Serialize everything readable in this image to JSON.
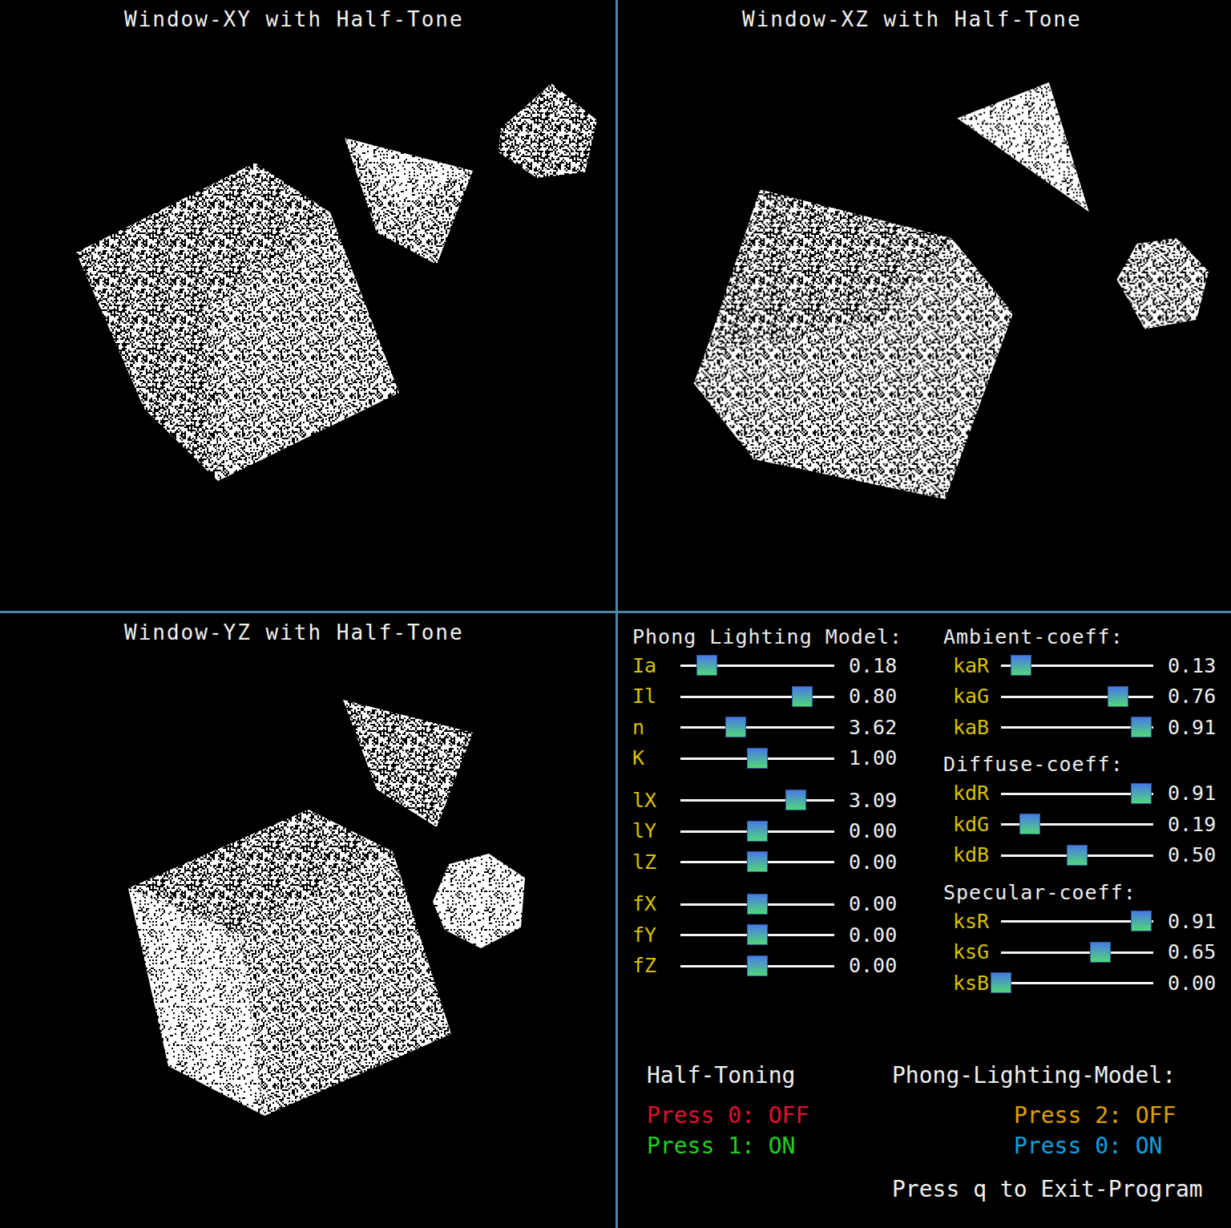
{
  "views": [
    {
      "title": "Window-XY with Half-Tone"
    },
    {
      "title": "Window-XZ with Half-Tone"
    },
    {
      "title": "Window-YZ with Half-Tone"
    }
  ],
  "lighting": {
    "title": "Phong Lighting Model:",
    "groups": [
      [
        {
          "label": "Ia",
          "level": 0.17,
          "reading": "0.18"
        },
        {
          "label": "Il",
          "level": 0.79,
          "reading": "0.80"
        },
        {
          "label": "n",
          "level": 0.36,
          "reading": "3.62"
        },
        {
          "label": "K",
          "level": 0.5,
          "reading": "1.00"
        }
      ],
      [
        {
          "label": "lX",
          "level": 0.75,
          "reading": "3.09"
        },
        {
          "label": "lY",
          "level": 0.5,
          "reading": "0.00"
        },
        {
          "label": "lZ",
          "level": 0.5,
          "reading": "0.00"
        }
      ],
      [
        {
          "label": "fX",
          "level": 0.5,
          "reading": "0.00"
        },
        {
          "label": "fY",
          "level": 0.5,
          "reading": "0.00"
        },
        {
          "label": "fZ",
          "level": 0.5,
          "reading": "0.00"
        }
      ]
    ]
  },
  "coefficients": [
    {
      "title": "Ambient-coeff:",
      "sliders": [
        {
          "label": "kaR",
          "level": 0.13,
          "reading": "0.13"
        },
        {
          "label": "kaG",
          "level": 0.77,
          "reading": "0.76"
        },
        {
          "label": "kaB",
          "level": 0.92,
          "reading": "0.91"
        }
      ]
    },
    {
      "title": "Diffuse-coeff:",
      "sliders": [
        {
          "label": "kdR",
          "level": 0.92,
          "reading": "0.91"
        },
        {
          "label": "kdG",
          "level": 0.19,
          "reading": "0.19"
        },
        {
          "label": "kdB",
          "level": 0.5,
          "reading": "0.50"
        }
      ]
    },
    {
      "title": "Specular-coeff:",
      "sliders": [
        {
          "label": "ksR",
          "level": 0.92,
          "reading": "0.91"
        },
        {
          "label": "ksG",
          "level": 0.65,
          "reading": "0.65"
        },
        {
          "label": "ksB",
          "level": 0.0,
          "reading": "0.00"
        }
      ]
    }
  ],
  "half_toning": {
    "title": "Half-Toning",
    "options": [
      {
        "label": "Press 0: OFF",
        "color": "#e01030"
      },
      {
        "label": "Press 1: ON",
        "color": "#20d020"
      }
    ]
  },
  "phong_toggle": {
    "title": "Phong-Lighting-Model:",
    "options": [
      {
        "label": "Press 2: OFF",
        "color": "#e0a000"
      },
      {
        "label": "Press 0: ON",
        "color": "#10a0e0"
      }
    ]
  },
  "exit_hint": "Press q to Exit-Program"
}
